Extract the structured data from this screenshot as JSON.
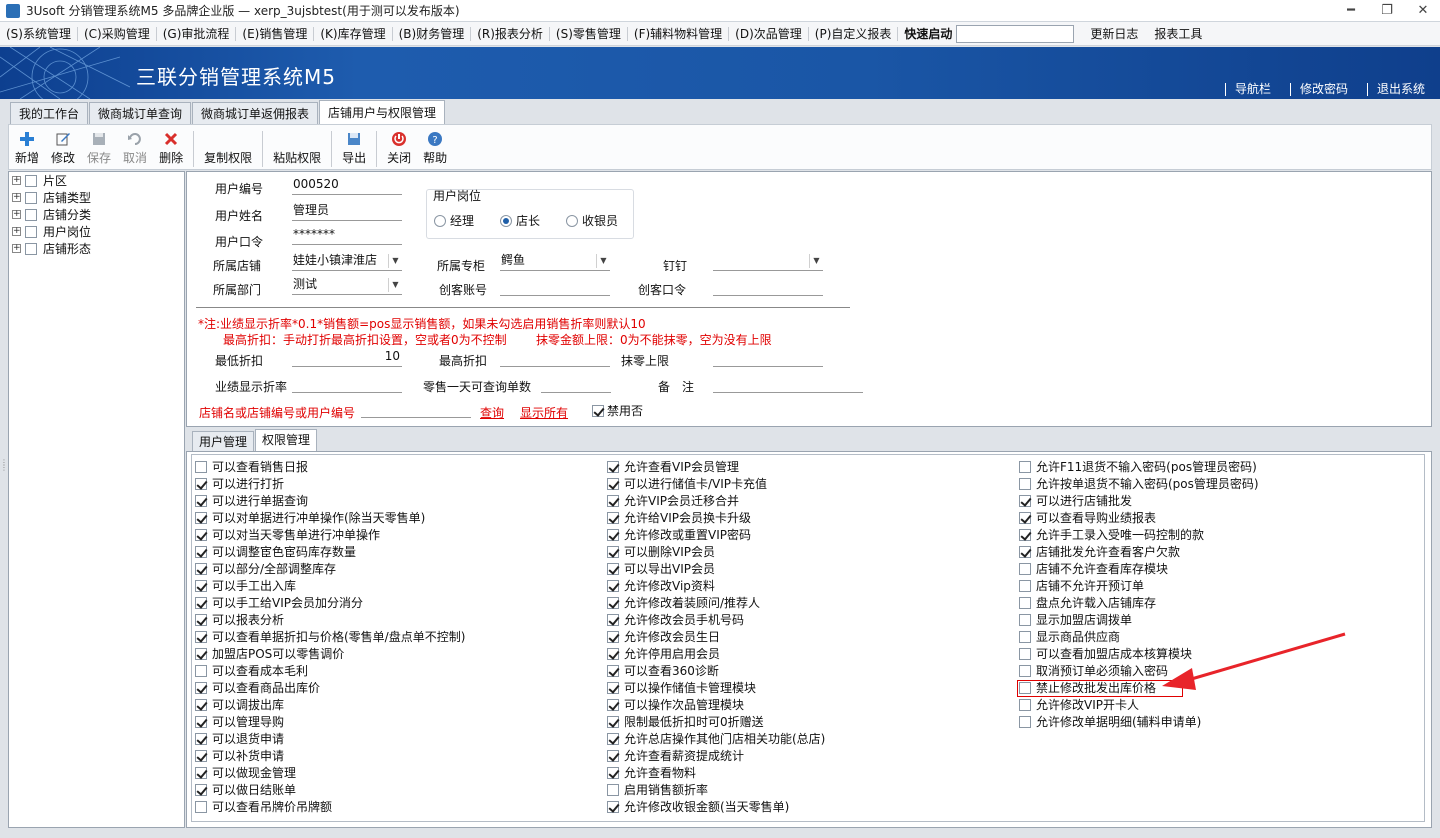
{
  "window": {
    "title": "3Usoft 分销管理系统M5 多品牌企业版 — xerp_3ujsbtest(用于测可以发布版本)"
  },
  "menu": {
    "items": [
      "(S)系统管理",
      "(C)采购管理",
      "(G)审批流程",
      "(E)销售管理",
      "(K)库存管理",
      "(B)财务管理",
      "(R)报表分析",
      "(S)零售管理",
      "(F)辅料物料管理",
      "(D)次品管理",
      "(P)自定义报表"
    ],
    "quick_label": "快速启动",
    "quick_value": "",
    "changelog": "更新日志",
    "report_tool": "报表工具"
  },
  "banner": {
    "brand": "三联分销管理系统M5",
    "links": [
      "导航栏",
      "修改密码",
      "退出系统"
    ]
  },
  "tabs": [
    "我的工作台",
    "微商城订单查询",
    "微商城订单返佣报表",
    "店铺用户与权限管理"
  ],
  "toolbar": {
    "new": "新增",
    "edit": "修改",
    "save": "保存",
    "cancel": "取消",
    "delete": "删除",
    "copy_perm": "复制权限",
    "paste_perm": "粘贴权限",
    "export": "导出",
    "close": "关闭",
    "help": "帮助"
  },
  "tree": [
    "片区",
    "店铺类型",
    "店铺分类",
    "用户岗位",
    "店铺形态"
  ],
  "form": {
    "user_id_label": "用户编号",
    "user_id": "000520",
    "user_name_label": "用户姓名",
    "user_name": "管理员",
    "password_label": "用户口令",
    "password": "*******",
    "position_group": "用户岗位",
    "positions": [
      "经理",
      "店长",
      "收银员"
    ],
    "store_label": "所属店铺",
    "store": "娃娃小镇津淮店",
    "counter_label": "所属专柜",
    "counter": "鳄鱼",
    "dingding_label": "钉钉",
    "dingding": "",
    "dept_label": "所属部门",
    "dept": "测试",
    "chuangke_acct_label": "创客账号",
    "chuangke_acct": "",
    "chuangke_pwd_label": "创客口令",
    "chuangke_pwd": "",
    "note1": "*注:业绩显示折率*0.1*销售额=pos显示销售额，如果未勾选启用销售折率则默认10",
    "note2": "最高折扣：手动打折最高折扣设置，空或者0为不控制",
    "note3": "抹零金额上限：0为不能抹零，空为没有上限",
    "min_discount_label": "最低折扣",
    "min_discount": "10",
    "max_discount_label": "最高折扣",
    "max_discount": "",
    "round_label": "抹零上限",
    "round": "",
    "perf_label": "业绩显示折率",
    "perf": "",
    "retail_days_label": "零售一天可查询单数",
    "retail_days": "",
    "remark_label": "备　注",
    "remark": "",
    "search_label": "店铺名或店铺编号或用户编号",
    "search_value": "",
    "query": "查询",
    "show_all": "显示所有",
    "disabled_label": "禁用否"
  },
  "subtabs": [
    "用户管理",
    "权限管理"
  ],
  "permissions": {
    "col1": [
      {
        "t": "可以查看销售日报",
        "c": false
      },
      {
        "t": "可以进行打折",
        "c": true
      },
      {
        "t": "可以进行单据查询",
        "c": true
      },
      {
        "t": "可以对单据进行冲单操作(除当天零售单)",
        "c": true
      },
      {
        "t": "可以对当天零售单进行冲单操作",
        "c": true
      },
      {
        "t": "可以调整宦色宦码库存数量",
        "c": true
      },
      {
        "t": "可以部分/全部调整库存",
        "c": true
      },
      {
        "t": "可以手工出入库",
        "c": true
      },
      {
        "t": "可以手工给VIP会员加分消分",
        "c": true
      },
      {
        "t": "可以报表分析",
        "c": true
      },
      {
        "t": "可以查看单据折扣与价格(零售单/盘点单不控制)",
        "c": true
      },
      {
        "t": "加盟店POS可以零售调价",
        "c": true
      },
      {
        "t": "可以查看成本毛利",
        "c": false
      },
      {
        "t": "可以查看商品出库价",
        "c": true
      },
      {
        "t": "可以调拔出库",
        "c": true
      },
      {
        "t": "可以管理导购",
        "c": true
      },
      {
        "t": "可以退货申请",
        "c": true
      },
      {
        "t": "可以补货申请",
        "c": true
      },
      {
        "t": "可以做现金管理",
        "c": true
      },
      {
        "t": "可以做日结账单",
        "c": true
      },
      {
        "t": "可以查看吊牌价吊牌额",
        "c": false
      }
    ],
    "col2": [
      {
        "t": "允许查看VIP会员管理",
        "c": true
      },
      {
        "t": "可以进行储值卡/VIP卡充值",
        "c": true
      },
      {
        "t": "允许VIP会员迁移合并",
        "c": true
      },
      {
        "t": "允许给VIP会员换卡升级",
        "c": true
      },
      {
        "t": "允许修改或重置VIP密码",
        "c": true
      },
      {
        "t": "可以删除VIP会员",
        "c": true
      },
      {
        "t": "可以导出VIP会员",
        "c": true
      },
      {
        "t": "允许修改Vip资料",
        "c": true
      },
      {
        "t": "允许修改着装顾问/推荐人",
        "c": true
      },
      {
        "t": "允许修改会员手机号码",
        "c": true
      },
      {
        "t": "允许修改会员生日",
        "c": true
      },
      {
        "t": "允许停用启用会员",
        "c": true
      },
      {
        "t": "可以查看360诊断",
        "c": true
      },
      {
        "t": "可以操作储值卡管理模块",
        "c": true
      },
      {
        "t": "可以操作次品管理模块",
        "c": true
      },
      {
        "t": "限制最低折扣时可0折赠送",
        "c": true
      },
      {
        "t": "允许总店操作其他门店相关功能(总店)",
        "c": true
      },
      {
        "t": "允许查看薪资提成统计",
        "c": true
      },
      {
        "t": "允许查看物料",
        "c": true
      },
      {
        "t": "启用销售额折率",
        "c": false
      },
      {
        "t": "允许修改收银金额(当天零售单)",
        "c": true
      }
    ],
    "col3": [
      {
        "t": "允许F11退货不输入密码(pos管理员密码)",
        "c": false
      },
      {
        "t": "允许按单退货不输入密码(pos管理员密码)",
        "c": false
      },
      {
        "t": "可以进行店铺批发",
        "c": true
      },
      {
        "t": "可以查看导购业绩报表",
        "c": true
      },
      {
        "t": "允许手工录入受唯一码控制的款",
        "c": true
      },
      {
        "t": "店铺批发允许查看客户欠款",
        "c": true
      },
      {
        "t": "店铺不允许查看库存模块",
        "c": false
      },
      {
        "t": "店铺不允许开预订单",
        "c": false
      },
      {
        "t": "盘点允许载入店铺库存",
        "c": false
      },
      {
        "t": "显示加盟店调拨单",
        "c": false
      },
      {
        "t": "显示商品供应商",
        "c": false
      },
      {
        "t": "可以查看加盟店成本核算模块",
        "c": false
      },
      {
        "t": "取消预订单必须输入密码",
        "c": false
      },
      {
        "t": "禁止修改批发出库价格",
        "c": false
      },
      {
        "t": "允许修改VIP开卡人",
        "c": false
      },
      {
        "t": "允许修改单据明细(辅料申请单)",
        "c": false
      }
    ]
  },
  "colors": {
    "accent": "#1a56a6",
    "note": "#e00000"
  }
}
